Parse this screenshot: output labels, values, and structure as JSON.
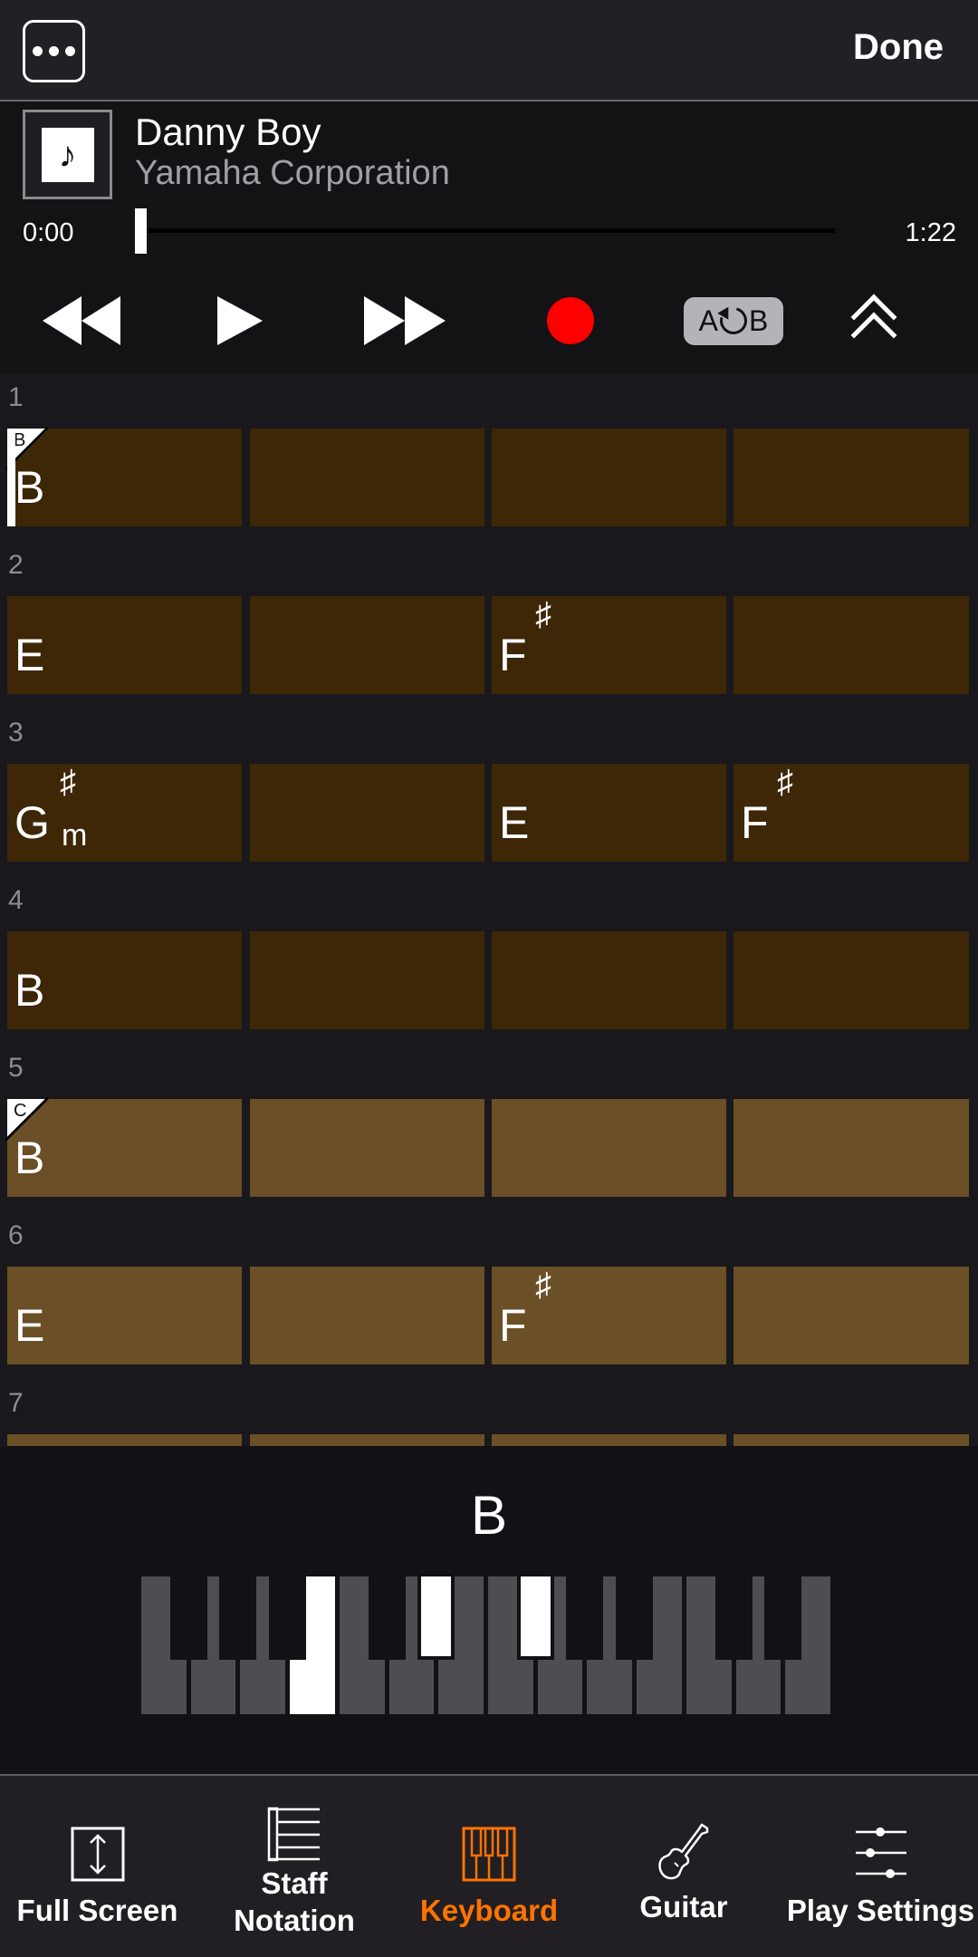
{
  "topbar": {
    "more_label": "More options",
    "done_label": "Done"
  },
  "player": {
    "title": "Danny Boy",
    "artist": "Yamaha Corporation",
    "time_current": "0:00",
    "time_total": "1:22",
    "progress": 0.0,
    "transport": {
      "rewind": "rewind-icon",
      "play": "play-icon",
      "fast_forward": "fast-forward-icon",
      "record": "record-icon",
      "ab_repeat_a": "A",
      "ab_repeat_b": "B",
      "collapse": "double-chevron-up-icon"
    },
    "colors": {
      "record": "#ff0000"
    }
  },
  "chord_sheet": {
    "measures": [
      {
        "number": "1",
        "section": "B",
        "played": true,
        "beats": [
          {
            "root": "B",
            "acc": "",
            "qual": ""
          },
          {
            "root": "",
            "acc": "",
            "qual": ""
          },
          {
            "root": "",
            "acc": "",
            "qual": ""
          },
          {
            "root": "",
            "acc": "",
            "qual": ""
          }
        ]
      },
      {
        "number": "2",
        "section": "",
        "played": true,
        "beats": [
          {
            "root": "E",
            "acc": "",
            "qual": ""
          },
          {
            "root": "",
            "acc": "",
            "qual": ""
          },
          {
            "root": "F",
            "acc": "♯",
            "qual": ""
          },
          {
            "root": "",
            "acc": "",
            "qual": ""
          }
        ]
      },
      {
        "number": "3",
        "section": "",
        "played": true,
        "beats": [
          {
            "root": "G",
            "acc": "♯",
            "qual": "m"
          },
          {
            "root": "",
            "acc": "",
            "qual": ""
          },
          {
            "root": "E",
            "acc": "",
            "qual": ""
          },
          {
            "root": "F",
            "acc": "♯",
            "qual": ""
          }
        ]
      },
      {
        "number": "4",
        "section": "",
        "played": true,
        "beats": [
          {
            "root": "B",
            "acc": "",
            "qual": ""
          },
          {
            "root": "",
            "acc": "",
            "qual": ""
          },
          {
            "root": "",
            "acc": "",
            "qual": ""
          },
          {
            "root": "",
            "acc": "",
            "qual": ""
          }
        ]
      },
      {
        "number": "5",
        "section": "C",
        "played": false,
        "beats": [
          {
            "root": "B",
            "acc": "",
            "qual": ""
          },
          {
            "root": "",
            "acc": "",
            "qual": ""
          },
          {
            "root": "",
            "acc": "",
            "qual": ""
          },
          {
            "root": "",
            "acc": "",
            "qual": ""
          }
        ]
      },
      {
        "number": "6",
        "section": "",
        "played": false,
        "beats": [
          {
            "root": "E",
            "acc": "",
            "qual": ""
          },
          {
            "root": "",
            "acc": "",
            "qual": ""
          },
          {
            "root": "F",
            "acc": "♯",
            "qual": ""
          },
          {
            "root": "",
            "acc": "",
            "qual": ""
          }
        ]
      },
      {
        "number": "7",
        "section": "",
        "played": false,
        "beats": [
          {
            "root": "",
            "acc": "",
            "qual": ""
          },
          {
            "root": "",
            "acc": "",
            "qual": ""
          },
          {
            "root": "",
            "acc": "",
            "qual": ""
          },
          {
            "root": "",
            "acc": "",
            "qual": ""
          }
        ]
      }
    ],
    "colors": {
      "section_dark": "#3d2707",
      "section_light": "#6b4f27"
    }
  },
  "keyboard": {
    "current_chord": "B",
    "white_keys": [
      "F",
      "G",
      "A",
      "B",
      "C",
      "D",
      "E",
      "F",
      "G",
      "A",
      "B",
      "C",
      "D",
      "E"
    ],
    "black_keys": [
      {
        "note": "F#",
        "after": 0
      },
      {
        "note": "G#",
        "after": 1
      },
      {
        "note": "A#",
        "after": 2
      },
      {
        "note": "C#",
        "after": 4
      },
      {
        "note": "D#",
        "after": 5
      },
      {
        "note": "F#",
        "after": 7
      },
      {
        "note": "G#",
        "after": 8
      },
      {
        "note": "A#",
        "after": 9
      },
      {
        "note": "C#",
        "after": 11
      },
      {
        "note": "D#",
        "after": 12
      }
    ],
    "highlighted_white": [
      3
    ],
    "highlighted_black": [
      4,
      5
    ]
  },
  "tabbar": {
    "tabs": [
      {
        "id": "full-screen",
        "label": "Full Screen",
        "icon": "fullscreen-icon",
        "active": false
      },
      {
        "id": "staff-notation",
        "label": "Staff\nNotation",
        "icon": "staff-notation-icon",
        "active": false
      },
      {
        "id": "keyboard",
        "label": "Keyboard",
        "icon": "keyboard-icon",
        "active": true
      },
      {
        "id": "guitar",
        "label": "Guitar",
        "icon": "guitar-icon",
        "active": false
      },
      {
        "id": "play-settings",
        "label": "Play Settings",
        "icon": "sliders-icon",
        "active": false
      }
    ],
    "colors": {
      "active": "#ff7300",
      "inactive": "#ffffff"
    }
  }
}
